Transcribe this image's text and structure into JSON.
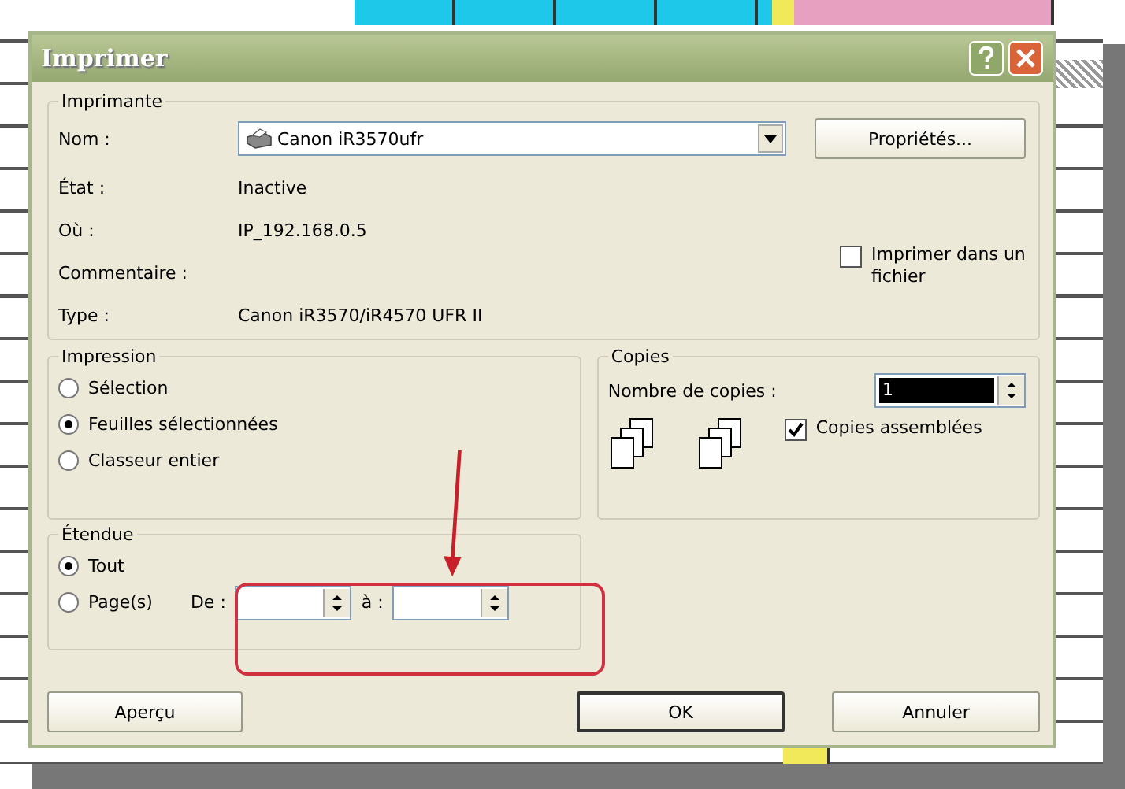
{
  "window": {
    "title": "Imprimer"
  },
  "printer": {
    "group_label": "Imprimante",
    "name_label": "Nom :",
    "name_value": "Canon iR3570ufr",
    "properties_button": "Propriétés...",
    "fields": [
      {
        "label": "État :",
        "value": "Inactive"
      },
      {
        "label": "Où :",
        "value": "IP_192.168.0.5"
      },
      {
        "label": "Commentaire :"
      },
      {
        "label": "Type :",
        "value": "Canon iR3570/iR4570 UFR II"
      }
    ],
    "print_to_file": {
      "label": "Imprimer dans un fichier",
      "checked": false
    }
  },
  "print_what": {
    "label": "Impression",
    "options": [
      {
        "label": "Sélection",
        "selected": false
      },
      {
        "label": "Feuilles sélectionnées",
        "selected": true
      },
      {
        "label": "Classeur entier",
        "selected": false
      }
    ]
  },
  "copies": {
    "label": "Copies",
    "count_label": "Nombre de copies :",
    "count_value": "1",
    "collate": {
      "label": "Copies assemblées",
      "checked": true
    }
  },
  "range": {
    "label": "Étendue",
    "options": [
      {
        "label": "Tout",
        "selected": true
      },
      {
        "label": "Page(s)",
        "selected": false
      }
    ],
    "from_label": "De :",
    "to_label": "à :"
  },
  "buttons": [
    {
      "label": "Aperçu",
      "default": false
    },
    {
      "label": "OK",
      "default": true
    },
    {
      "label": "Annuler",
      "default": false
    }
  ]
}
